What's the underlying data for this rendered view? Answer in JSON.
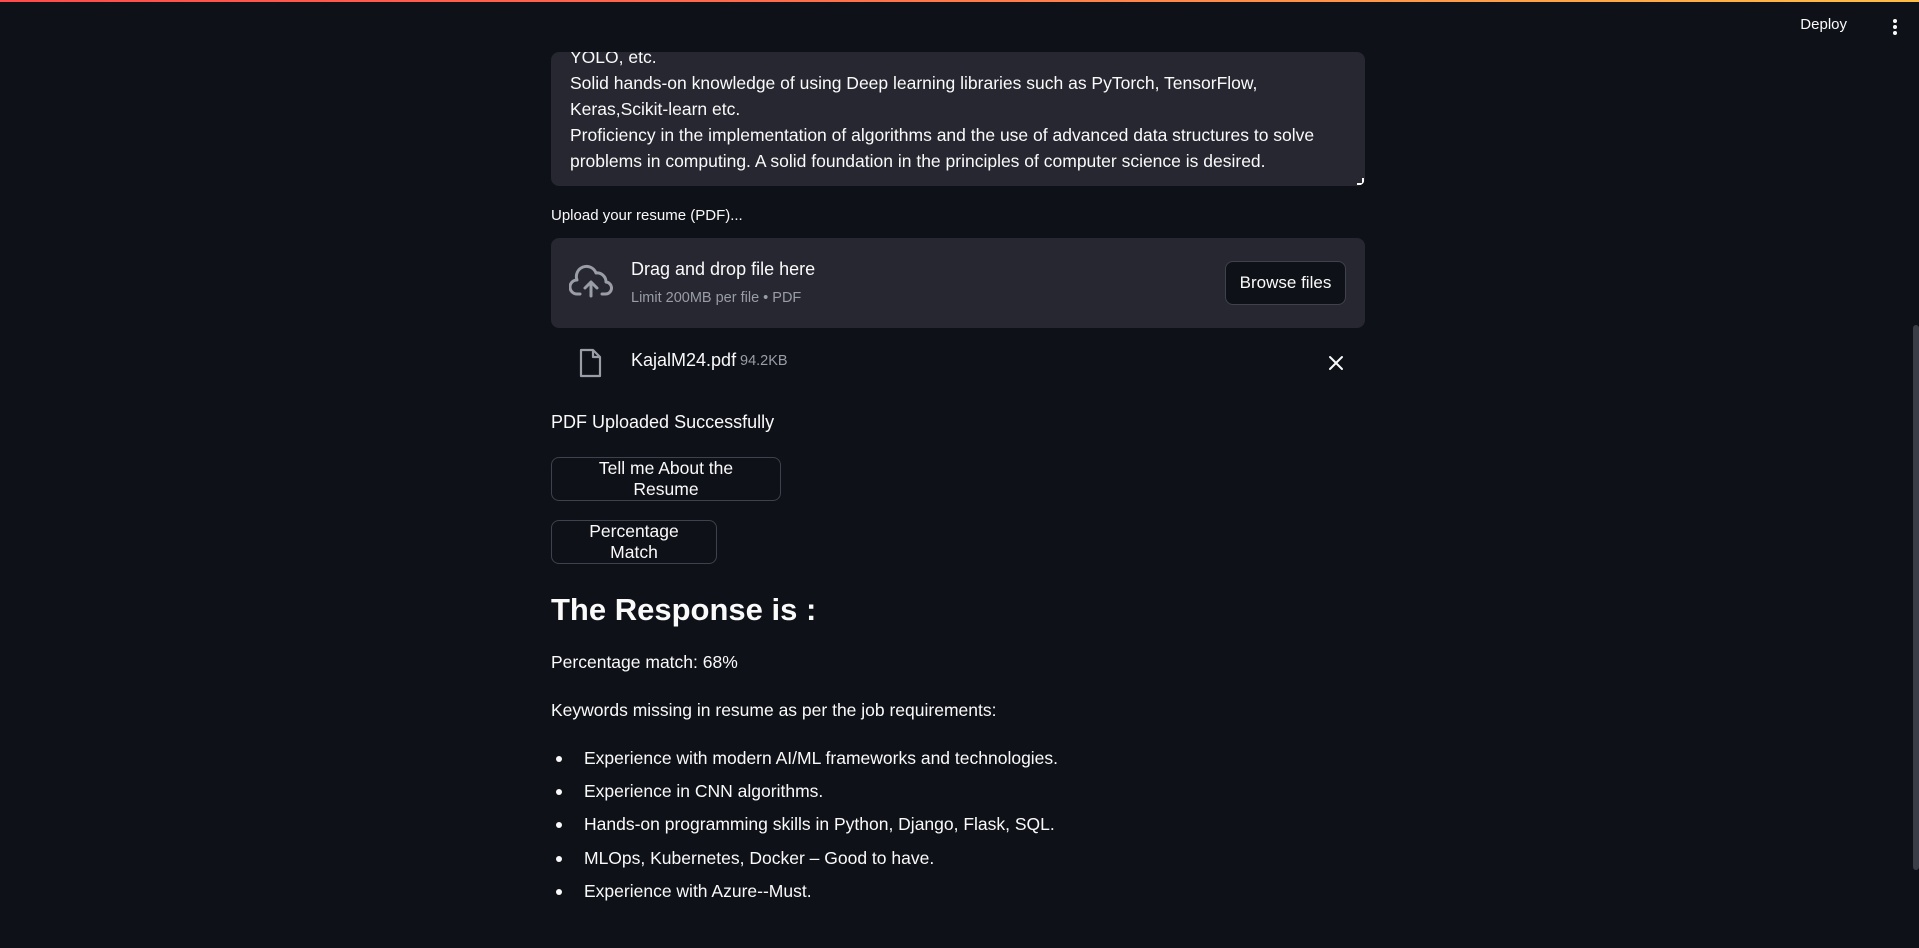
{
  "header": {
    "deploy_label": "Deploy",
    "menu_icon": "more-vertical-icon"
  },
  "job_description": {
    "text": "YOLO, etc.\nSolid hands-on knowledge of using Deep learning libraries such as PyTorch, TensorFlow,\nKeras,Scikit-learn etc.\nProficiency in the implementation of algorithms and the use of advanced data structures to solve\nproblems in computing. A solid foundation in the principles of computer science is desired."
  },
  "uploader": {
    "label": "Upload your resume (PDF)...",
    "drop_title": "Drag and drop file here",
    "drop_subtitle": "Limit 200MB per file • PDF",
    "browse_label": "Browse files",
    "file": {
      "name": "KajalM24.pdf",
      "size": "94.2KB"
    }
  },
  "status": {
    "upload_message": "PDF Uploaded Successfully"
  },
  "actions": {
    "tell_label": "Tell me About the Resume",
    "percentage_label": "Percentage Match"
  },
  "response": {
    "heading": "The Response is :",
    "percentage": "Percentage match: 68%",
    "keywords_intro": "Keywords missing in resume as per the job requirements:",
    "items": [
      "Experience with modern AI/ML frameworks and technologies.",
      "Experience in CNN algorithms.",
      "Hands-on programming skills in Python, Django, Flask, SQL.",
      "MLOps, Kubernetes, Docker – Good to have.",
      "Experience with Azure--Must."
    ]
  },
  "colors": {
    "background": "#0e1117",
    "surface": "#262730",
    "text": "#fafafa",
    "muted": "#9a9ca6",
    "accent_start": "#ff4b4b",
    "accent_end": "#ffbd45"
  }
}
